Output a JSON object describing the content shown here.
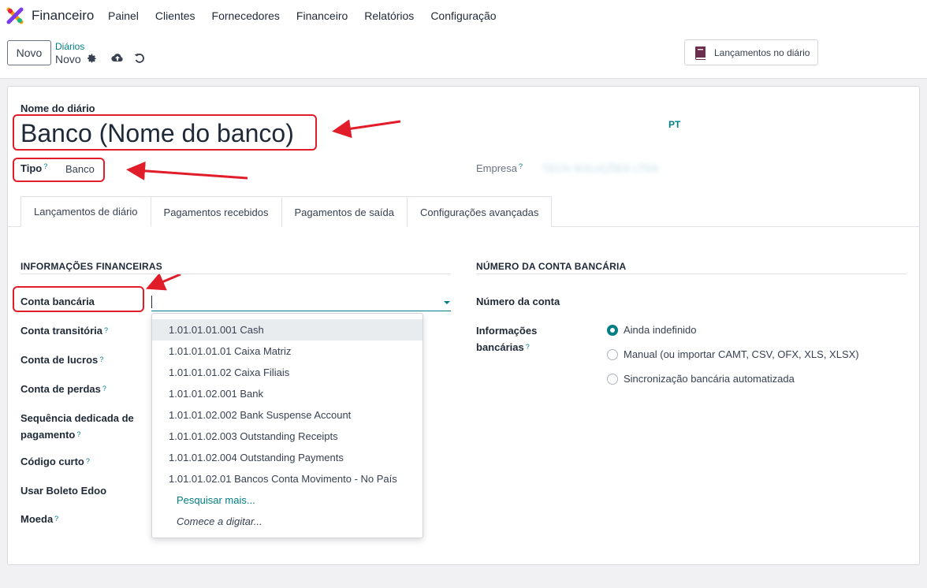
{
  "app": {
    "title": "Financeiro",
    "menu": [
      "Painel",
      "Clientes",
      "Fornecedores",
      "Financeiro",
      "Relatórios",
      "Configuração"
    ]
  },
  "control": {
    "new_button": "Novo",
    "breadcrumb": "Diários",
    "record": "Novo",
    "journal_entries_button": "Lançamentos no diário"
  },
  "form": {
    "name_label": "Nome do diário",
    "name_value": "Banco (Nome do banco)",
    "lang": "PT",
    "type_label": "Tipo",
    "type_value": "Banco",
    "company_label": "Empresa",
    "company_value": "TECH SOLUÇÕES LTDA",
    "help_mark": "?"
  },
  "tabs": [
    "Lançamentos de diário",
    "Pagamentos recebidos",
    "Pagamentos de saída",
    "Configurações avançadas"
  ],
  "financial": {
    "section_title": "INFORMAÇÕES FINANCEIRAS",
    "fields": {
      "bank_account": "Conta bancária",
      "transit_account": "Conta transitória",
      "profit_account": "Conta de lucros",
      "loss_account": "Conta de perdas",
      "payment_sequence_1": "Sequência dedicada de",
      "payment_sequence_2": "pagamento",
      "short_code": "Código curto",
      "boleto": "Usar Boleto Edoo",
      "currency": "Moeda"
    }
  },
  "dropdown": {
    "items": [
      "1.01.01.01.001 Cash",
      "1.01.01.01.01 Caixa Matriz",
      "1.01.01.01.02 Caixa Filiais",
      "1.01.01.02.001 Bank",
      "1.01.01.02.002 Bank Suspense Account",
      "1.01.01.02.003 Outstanding Receipts",
      "1.01.01.02.004 Outstanding Payments",
      "1.01.01.02.01 Bancos Conta Movimento - No País"
    ],
    "search_more": "Pesquisar mais...",
    "start_typing": "Comece a digitar..."
  },
  "bank": {
    "section_title": "NÚMERO DA CONTA BANCÁRIA",
    "account_number_label": "Número da conta",
    "bank_info_label_1": "Informações",
    "bank_info_label_2": "bancárias",
    "options": [
      "Ainda indefinido",
      "Manual (ou importar CAMT, CSV, OFX, XLS, XLSX)",
      "Sincronização bancária automatizada"
    ],
    "selected_option": "Ainda indefinido"
  },
  "colors": {
    "accent": "#017e84",
    "highlight_box": "#e11d2a"
  }
}
